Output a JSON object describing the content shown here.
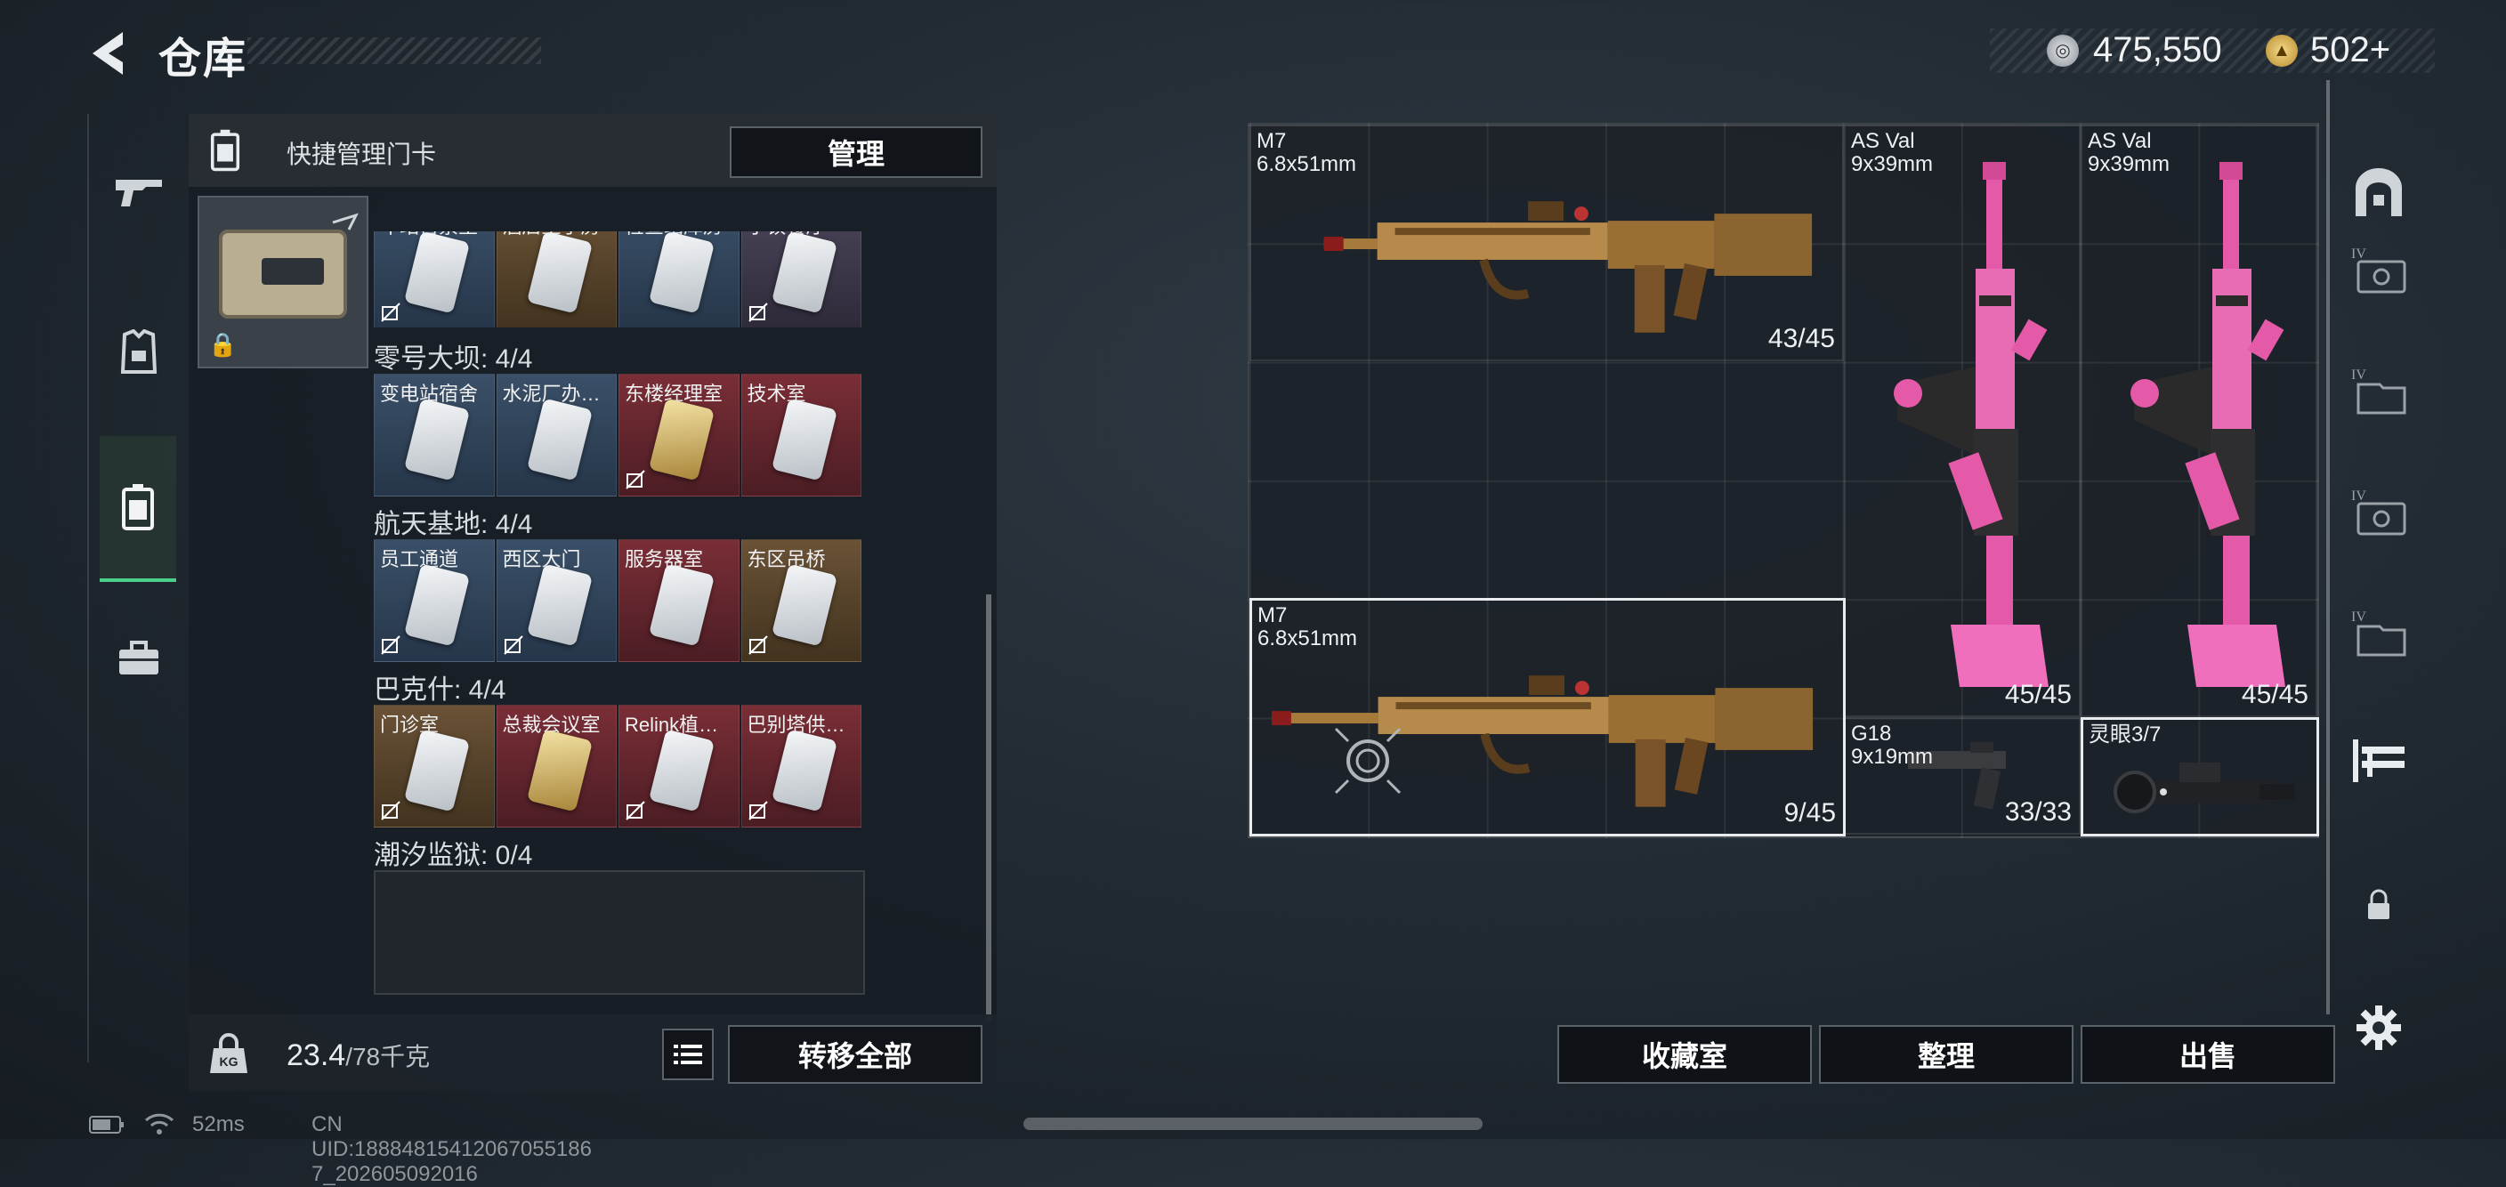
{
  "header": {
    "title": "仓库",
    "silver_amount": "475,550",
    "gold_amount": "502+"
  },
  "rail": {
    "items": [
      {
        "icon": "gun-icon"
      },
      {
        "icon": "armor-icon"
      },
      {
        "icon": "keycard-case-icon",
        "active": true
      },
      {
        "icon": "toolbox-icon"
      }
    ]
  },
  "key_panel": {
    "title": "快捷管理门卡",
    "manage_label": "管理",
    "groups": [
      {
        "label": "零号大坝: 4/4",
        "keys": [
          {
            "name": "变电站宿舍",
            "bg": "blue",
            "card": "white",
            "no_disc": false
          },
          {
            "name": "水泥厂办…",
            "bg": "blue",
            "card": "white",
            "no_disc": false
          },
          {
            "name": "东楼经理室",
            "bg": "red",
            "card": "gold",
            "no_disc": true
          },
          {
            "name": "技术室",
            "bg": "red",
            "card": "white",
            "no_disc": false
          }
        ]
      },
      {
        "label": "航天基地: 4/4",
        "keys": [
          {
            "name": "员工通道",
            "bg": "blue",
            "card": "white",
            "no_disc": true
          },
          {
            "name": "西区大门",
            "bg": "blue",
            "card": "white",
            "no_disc": true
          },
          {
            "name": "服务器室",
            "bg": "red",
            "card": "white",
            "no_disc": false
          },
          {
            "name": "东区吊桥",
            "bg": "brown",
            "card": "white",
            "no_disc": true
          }
        ]
      },
      {
        "label": "巴克什: 4/4",
        "keys": [
          {
            "name": "门诊室",
            "bg": "brown",
            "card": "white",
            "no_disc": true
          },
          {
            "name": "总裁会议室",
            "bg": "red",
            "card": "gold",
            "no_disc": false
          },
          {
            "name": "Relink植…",
            "bg": "red",
            "card": "white",
            "no_disc": true
          },
          {
            "name": "巴别塔供…",
            "bg": "red",
            "card": "white",
            "no_disc": true
          }
        ]
      },
      {
        "label": "潮汐监狱: 0/4",
        "keys": []
      }
    ],
    "top_row": [
      {
        "name": "车站售票室",
        "bg": "blue",
        "card": "white",
        "no_disc": true
      },
      {
        "name": "酒店王子房",
        "bg": "brown",
        "card": "white",
        "no_disc": false
      },
      {
        "name": "检查站库房",
        "bg": "blue",
        "card": "white",
        "no_disc": false
      },
      {
        "name": "小镇餐厅",
        "bg": "purple",
        "card": "white",
        "no_disc": true
      }
    ],
    "weight_current": "23.4",
    "weight_max": "/78千克",
    "transfer_label": "转移全部"
  },
  "weapons": [
    {
      "name": "M7",
      "caliber": "6.8x51mm",
      "count": "43/45",
      "selected": false,
      "kind": "rifle"
    },
    {
      "name": "AS Val",
      "caliber": "9x39mm",
      "count": "45/45",
      "selected": false,
      "kind": "pink"
    },
    {
      "name": "AS Val",
      "caliber": "9x39mm",
      "count": "45/45",
      "selected": false,
      "kind": "pink"
    },
    {
      "name": "M7",
      "caliber": "6.8x51mm",
      "count": "9/45",
      "selected": true,
      "kind": "rifle"
    },
    {
      "name": "G18",
      "caliber": "9x19mm",
      "count": "33/33",
      "selected": false,
      "kind": "pistol"
    },
    {
      "name": "灵眼3/7",
      "caliber": "",
      "count": "",
      "selected": true,
      "kind": "scope"
    }
  ],
  "right_rail": {
    "items": [
      {
        "icon": "safe-box-icon"
      },
      {
        "icon": "storage-iv-1-icon",
        "label": "IV"
      },
      {
        "icon": "storage-iv-2-icon",
        "label": "IV"
      },
      {
        "icon": "storage-iv-3-icon",
        "label": "IV"
      },
      {
        "icon": "storage-iv-4-icon",
        "label": "IV"
      },
      {
        "icon": "weapon-rack-icon"
      },
      {
        "icon": "lock-icon"
      },
      {
        "icon": "gear-icon"
      }
    ]
  },
  "bottom_buttons": {
    "collection": "收藏室",
    "sort": "整理",
    "sell": "出售"
  },
  "status": {
    "ping": "52ms",
    "uid": "CN UID:18884815412067055186​7_202605092016"
  },
  "colors": {
    "accent": "#4ad08a",
    "pink": "#e55aa8",
    "gold": "#c9a24a"
  }
}
